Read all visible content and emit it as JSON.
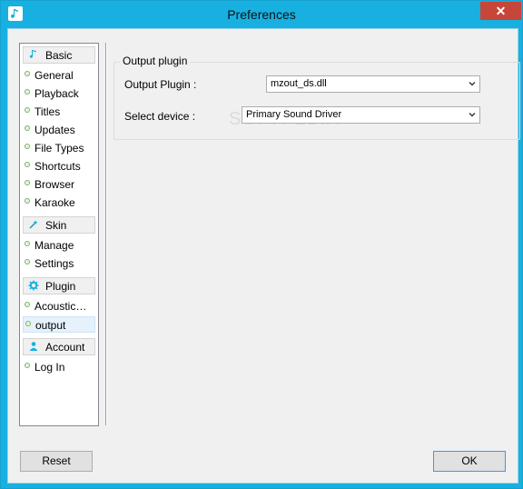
{
  "window": {
    "title": "Preferences",
    "close_glyph": "✕",
    "accent": "#17b0e0"
  },
  "sidebar": {
    "categories": [
      {
        "label": "Basic",
        "icon": "music-note-icon",
        "items": [
          "General",
          "Playback",
          "Titles",
          "Updates",
          "File Types",
          "Shortcuts",
          "Browser",
          "Karaoke"
        ]
      },
      {
        "label": "Skin",
        "icon": "magic-wand-icon",
        "items": [
          "Manage",
          "Settings"
        ]
      },
      {
        "label": "Plugin",
        "icon": "gear-icon",
        "items": [
          "Acoustic…",
          "output"
        ]
      },
      {
        "label": "Account",
        "icon": "user-icon",
        "items": [
          "Log In"
        ]
      }
    ],
    "selected_item": "output"
  },
  "main": {
    "group_title": "Output plugin",
    "output_plugin_label": "Output Plugin :",
    "output_plugin_value": "mzout_ds.dll",
    "select_device_label": "Select device :",
    "select_device_value": "Primary Sound Driver"
  },
  "footer": {
    "reset_label": "Reset",
    "ok_label": "OK"
  },
  "watermark": "SOFTPEDIA"
}
